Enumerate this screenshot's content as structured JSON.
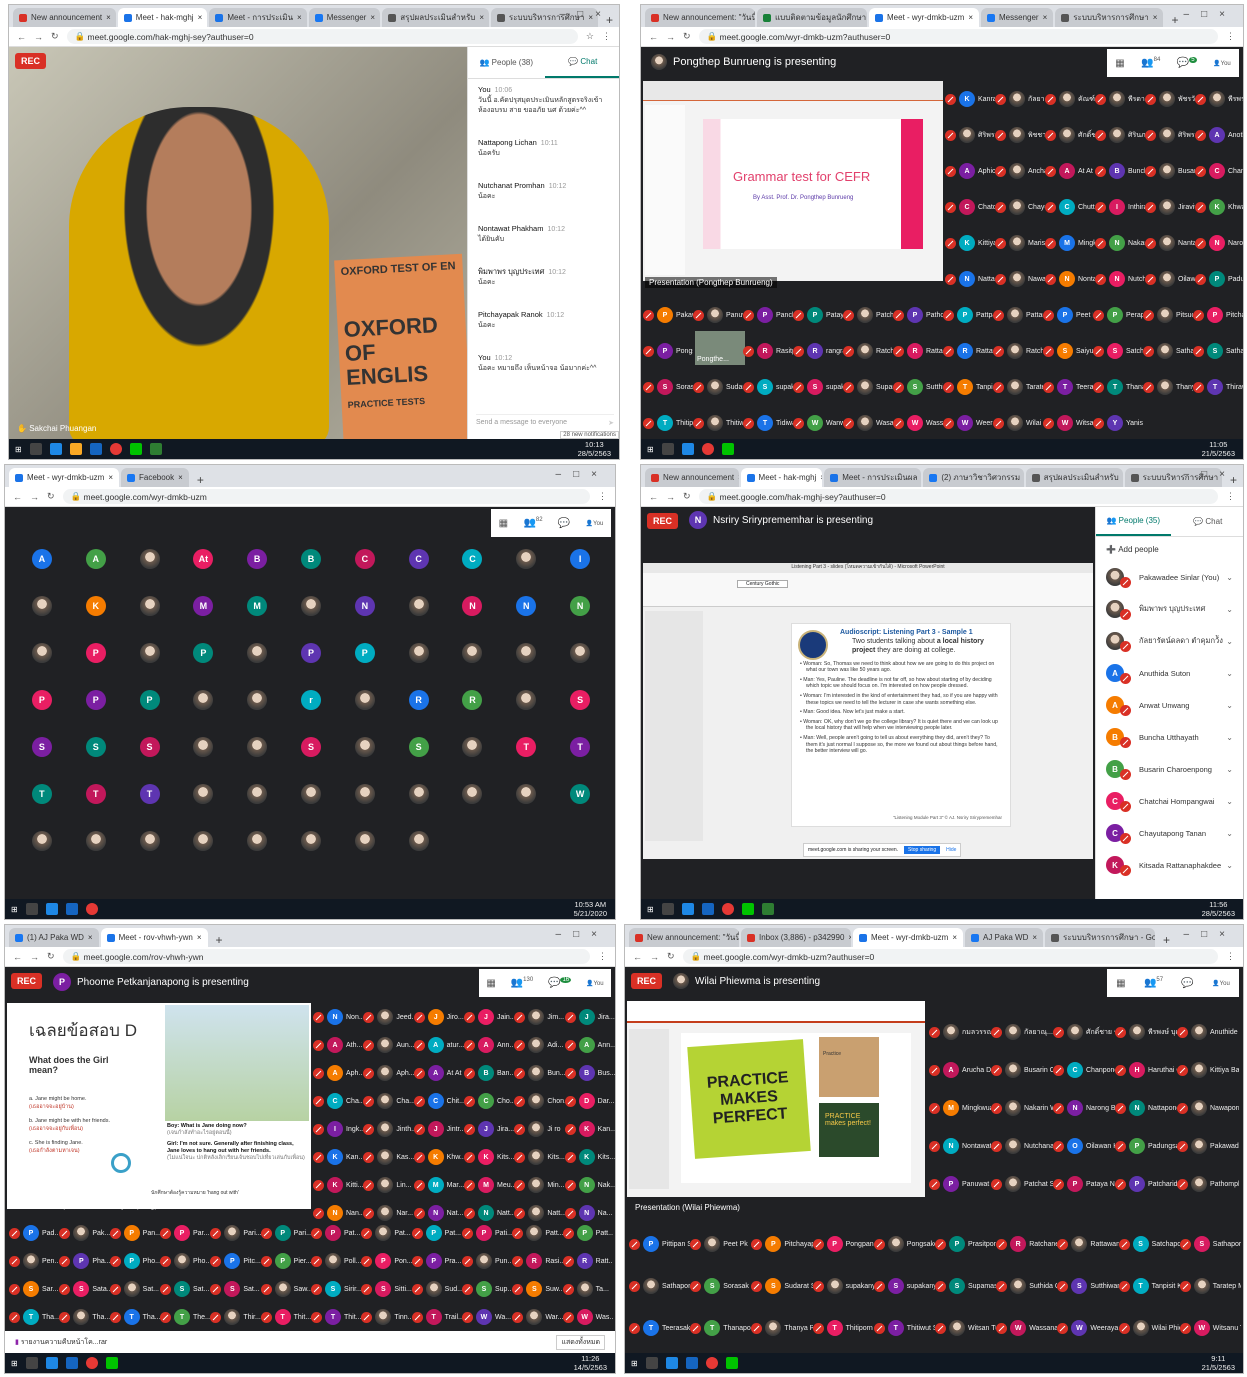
{
  "panel1": {
    "tabs": [
      {
        "label": "New announcement",
        "color": "#d93025"
      },
      {
        "label": "Meet - hak-mghj",
        "color": "#1a73e8",
        "active": true
      },
      {
        "label": "Meet - การประเมิน",
        "color": "#1a73e8"
      },
      {
        "label": "Messenger",
        "color": "#1877f2"
      },
      {
        "label": "สรุปผลประเมินสำหรับ",
        "color": "#555"
      },
      {
        "label": "ระบบบริหารการศึกษา",
        "color": "#555"
      }
    ],
    "url": "meet.google.com/hak-mghj-sey?authuser=0",
    "rec": "REC",
    "video_name": "Sakchai Phuangan",
    "book_text1": "OXFORD TEST OF EN",
    "book_text2": "OXFORD OF ENGLIS",
    "book_text3": "PRACTICE TESTS",
    "people_tab": "People (38)",
    "chat_tab": "Chat",
    "messages": [
      {
        "name": "You",
        "time": "10:06",
        "text": "วันนี้ อ.คัดปรุสมุดประเมินหลักสูตรจริงเข้าห้องอบรม สาย ขออภัย นศ ด้วยค่ะ^^"
      },
      {
        "name": "Nattapong Lichan",
        "time": "10:11",
        "text": "น้อครับ"
      },
      {
        "name": "Nutchanat Promhan",
        "time": "10:12",
        "text": "น้อคะ"
      },
      {
        "name": "Nontawat Phakham",
        "time": "10:12",
        "text": "ได้ยินคับ"
      },
      {
        "name": "พิมพาพร บุญประเทศ",
        "time": "10:12",
        "text": "น้อคะ"
      },
      {
        "name": "Pitchayapak Ranok",
        "time": "10:12",
        "text": "น้อคะ"
      },
      {
        "name": "You",
        "time": "10:12",
        "text": "น้อคะ หมายถึง เห็นหน้าจอ น้อมากค่ะ^^"
      }
    ],
    "send_placeholder": "Send a message to everyone",
    "new_notifications": "28 new notifications",
    "clock_time": "10:13",
    "clock_date": "28/5/2563"
  },
  "panel2": {
    "tabs": [
      {
        "label": "New announcement: \"วันนี้\"",
        "color": "#d93025"
      },
      {
        "label": "แบบติดตามข้อมูลนักศึกษา",
        "color": "#188038"
      },
      {
        "label": "Meet - wyr-dmkb-uzm",
        "color": "#1a73e8",
        "active": true
      },
      {
        "label": "Messenger",
        "color": "#1877f2"
      },
      {
        "label": "ระบบบริหารการศึกษา",
        "color": "#555"
      }
    ],
    "url": "meet.google.com/wyr-dmkb-uzm?authuser=0",
    "presenter": "Pongthep Bunrueng is presenting",
    "people_count": "84",
    "chat_count": "5",
    "you": "You",
    "slide_title": "Grammar test for CEFR",
    "slide_sub": "By Asst. Prof. Dr. Pongthep Bunrueng",
    "caption": "Presentation (Pongthep Bunrueng)",
    "presenter_tile": "Pongthe...",
    "rows": [
      [
        "Kanrat...",
        "กัลยาณุ...",
        "คัณฑ์กันต์...",
        "พีรดา บ...",
        "พัชรวัน...",
        "พีรพร ชั..."
      ],
      [
        "ศิริพร สี...",
        "พิชชาพร...",
        "ศักดิ์ชาย...",
        "ศิรินภา...",
        "ศิริพร...",
        "Anothid..."
      ],
      [
        "Aphichit...",
        "Ancha ...",
        "At At",
        "Buncha ...",
        "Busarin ...",
        "Chanipo..."
      ],
      [
        "Chatcha...",
        "Chayuta...",
        "Chutthai...",
        "Inthira S...",
        "Jiravit ...",
        "Khwanc..."
      ],
      [
        "Kittiya B...",
        "Marisa ...",
        "Mingkw...",
        "Nakarin ...",
        "Nantaw...",
        "Narong ..."
      ],
      [
        "Nattapo...",
        "Nawapo...",
        "Nontaw...",
        "Nutchan...",
        "Oilawan ...",
        "Padung..."
      ],
      [
        "Pakawa...",
        "Panuwa...",
        "Pancha...",
        "Pataya N...",
        "Patchari...",
        "Pathom...",
        "Pattpan ...",
        "Pattara...",
        "Peet Pk",
        "Perapas...",
        "Pitsuc...",
        "Pitchaya..."
      ],
      [
        "Pongsa...",
        "Pongthe...",
        "Rasitpo...",
        "rangrak...",
        "Ratchan...",
        "Rattakit ...",
        "Rattawa...",
        "Ratchrue...",
        "Saiyut ...",
        "Satchap...",
        "Sathapo...",
        "Sathapo..."
      ],
      [
        "Sorasak ...",
        "Sudarat ...",
        "supakan...",
        "supakan...",
        "Supama...",
        "Sutthiw...",
        "Tanpisit ...",
        "Taratep ...",
        "Teerasa...",
        "Thanap...",
        "Thanya ...",
        "Thirawa..."
      ],
      [
        "Thitipor...",
        "Thitiwut ...",
        "Tidiwat ...",
        "Wanwar...",
        "Wasan T...",
        "Wassan...",
        "Weeraya...",
        "Wilai Phi...",
        "Witsanu ...",
        "Yanisa P..."
      ]
    ],
    "clock_time": "11:05",
    "clock_date": "21/5/2563"
  },
  "panel3": {
    "tabs": [
      {
        "label": "Meet - wyr-dmkb-uzm",
        "color": "#1a73e8",
        "active": true
      },
      {
        "label": "Facebook",
        "color": "#1877f2"
      }
    ],
    "url": "meet.google.com/wyr-dmkb-uzm",
    "people_count": "82",
    "you": "You",
    "avatars": [
      "A",
      "A",
      "",
      "At",
      "B",
      "B",
      "C",
      "C",
      "C",
      "",
      "I",
      "",
      "K",
      "",
      "M",
      "M",
      "",
      "N",
      "",
      "N",
      "N",
      "N",
      "",
      "P",
      "",
      "P",
      "",
      "P",
      "P",
      "",
      "",
      "",
      "",
      "P",
      "P",
      "P",
      "",
      "",
      "r",
      "",
      "R",
      "R",
      "",
      "S",
      "S",
      "S",
      "S",
      "",
      "",
      "S",
      "",
      "S",
      "",
      "T",
      "T",
      "T",
      "T",
      "T",
      "",
      "",
      "",
      "",
      "",
      "",
      "",
      "W",
      "",
      "",
      "",
      "",
      "",
      "",
      "",
      ""
    ],
    "clock_time": "10:53 AM",
    "clock_date": "5/21/2020"
  },
  "panel4": {
    "tabs": [
      {
        "label": "New announcement",
        "color": "#d93025"
      },
      {
        "label": "Meet - hak-mghj",
        "color": "#1a73e8",
        "active": true
      },
      {
        "label": "Meet - การประเมินผล",
        "color": "#1a73e8"
      },
      {
        "label": "(2) ภาษาวิชาวิศวกรรม",
        "color": "#1877f2"
      },
      {
        "label": "สรุปผลประเมินสำหรับ",
        "color": "#555"
      },
      {
        "label": "ระบบบริหารการศึกษา",
        "color": "#555"
      }
    ],
    "url": "meet.google.com/hak-mghj-sey?authuser=0",
    "rec": "REC",
    "presenter": "Nsriry Sriryprememhar is presenting",
    "presenter_initial": "N",
    "ppt_title": "Listening Part 3 - slides (โหมดความเข้ากันได้) - Microsoft PowerPoint",
    "font_name": "Century Gothic",
    "script_title": "Audioscript: Listening Part 3 - Sample 1",
    "script_sub1": "Two students talking about",
    "script_sub_bold": "a local history",
    "script_sub2": "project",
    "script_sub3": "they are doing at college.",
    "lines": [
      "Woman: So, Thomas we need to think about how we are going to do this project on what our town was like 50 years ago.",
      "Man: Yes, Pauline. The deadline is not far off, so how about starting of by deciding which topic we should focus on. I'm interested on how people dressed.",
      "Woman: I'm interested in the kind of entertainment they had, so if you are happy with these topics we need to tell the lecturer in case she wants something else.",
      "Man: Good idea. Now let's just make a start.",
      "Woman: OK, why don't we go the college library? It is quiet there and we can look up the local history that will help when we interviewing people later.",
      "Man: Well, people aren't going to tell us about everything they did, aren't they? To them it's just normal I suppose so, the more we found out about things before hand, the better interview will go."
    ],
    "credit": "\"Listening Module Part 3\" © AJ. Nsriry Sriryprememhar",
    "share_notice": "meet.google.com is sharing your screen.",
    "stop_sharing": "Stop sharing",
    "hide": "Hide",
    "people_tab": "People (35)",
    "chat_tab": "Chat",
    "add_people": "Add people",
    "people": [
      {
        "name": "Pakawadee Sinlar (You)",
        "initial": "",
        "color": ""
      },
      {
        "name": "พิมพาพร บุญประเทศ",
        "initial": "",
        "color": ""
      },
      {
        "name": "กัลยารัตน์ดลดา ตำคุมกว้ัง",
        "initial": "",
        "color": ""
      },
      {
        "name": "Anuthida Suton",
        "initial": "A",
        "color": "#1a73e8"
      },
      {
        "name": "Anwat Unwang",
        "initial": "A",
        "color": "#f57c00"
      },
      {
        "name": "Buncha Utthayath",
        "initial": "B",
        "color": "#f57c00"
      },
      {
        "name": "Busarin Charoenpong",
        "initial": "B",
        "color": "#43a047"
      },
      {
        "name": "Chatchai Hompangwai",
        "initial": "C",
        "color": "#e91e63"
      },
      {
        "name": "Chayutapong Tanan",
        "initial": "C",
        "color": "#7b1fa2"
      },
      {
        "name": "Kitsada Rattanaphakdee",
        "initial": "K",
        "color": "#c2185b"
      }
    ],
    "clock_time": "11:56",
    "clock_date": "28/5/2563"
  },
  "panel5": {
    "tabs": [
      {
        "label": "(1) AJ Paka WD",
        "color": "#1877f2"
      },
      {
        "label": "Meet - rov-vhwh-ywn",
        "color": "#1a73e8",
        "active": true
      }
    ],
    "url": "meet.google.com/rov-vhwh-ywn",
    "rec": "REC",
    "presenter": "Phoome Petkanjanapong is presenting",
    "presenter_initial": "P",
    "people_count": "130",
    "chat_count": "16",
    "you": "You",
    "slide_heading": "เฉลยข้อสอบ D",
    "question": "What does the Girl mean?",
    "options": [
      {
        "en": "a.  Jane might be home.",
        "th": "(เธออาจจะอยู่บ้าน)"
      },
      {
        "en": "b.  Jane might be with her friends.",
        "th": "(เธออาจจะอยู่กับเพื่อน)"
      },
      {
        "en": "c.  She is finding Jane.",
        "th": "(เธอกำลังตามหาเจน)"
      }
    ],
    "boy_line": "Boy: What is Jane doing now?",
    "boy_th": "(เจนกำลังทำอะไรอยู่ตอนนี้)",
    "girl_line": "Girl: I'm not sure. Generally after finishing class, Jane loves to hang out with her friends.",
    "girl_th": "(ไม่แน่ใจนะ ปกติหลังเลิกเรียนเจ้นชอบไปเที่ยวเล่นกับเพื่อน)",
    "note": "นักศึกษาต้องรู้ความหมาย 'hang out with'",
    "caption": "Presentation (Phoome Petkanjanapong)",
    "side_names": [
      "Non...",
      "Jeed...",
      "Jiro...",
      "Jain...",
      "Jim...",
      "Jira...",
      "Ath...",
      "Aun...",
      "atur...",
      "Ann...",
      "Adi...",
      "Ann...",
      "Aph...",
      "Aph...",
      "At At",
      "Ban...",
      "Bun...",
      "Bus...",
      "Cha...",
      "Cha...",
      "Chit...",
      "Cho...",
      "Chon...",
      "Dar...",
      "Ingk...",
      "Jinth...",
      "Jintr...",
      "Jira...",
      "Ji ro",
      "Kan...",
      "Kan...",
      "Kas...",
      "Khw...",
      "Kits...",
      "Kits...",
      "Kits...",
      "Kitti...",
      "Lin...",
      "Mar...",
      "Meu...",
      "Min...",
      "Nak...",
      "Nan...",
      "Nar...",
      "Nat...",
      "Natt...",
      "Natt...",
      "Na...",
      "Net...",
      "Non...",
      "Nut...",
      "Pac..."
    ],
    "bottom_rows": [
      [
        "Pad...",
        "Pak...",
        "Pan...",
        "Par...",
        "Pari...",
        "Pari...",
        "Pat...",
        "Pat...",
        "Pat...",
        "Pati...",
        "Patt...",
        "Patt..."
      ],
      [
        "Pen...",
        "Pha...",
        "Pho...",
        "Pho...",
        "Pitc...",
        "Pier...",
        "Poll...",
        "Pon...",
        "Pra...",
        "Pun...",
        "Rasi...",
        "Ratt...",
        "Ritti...",
        "Rue..."
      ],
      [
        "Sar...",
        "Sata...",
        "Sat...",
        "Sat...",
        "Sat...",
        "Saw...",
        "Sirir...",
        "Sitti...",
        "Sud...",
        "Sup...",
        "Suw...",
        "Ta...",
        "Tan...",
        "Tara...",
        "Teer...",
        "Teer..."
      ],
      [
        "Tha...",
        "Tha...",
        "Tha...",
        "The...",
        "Thir...",
        "Thit...",
        "Thit...",
        "Tinn...",
        "Trail...",
        "Wa...",
        "War...",
        "Was...",
        "Wee...",
        "Wila...",
        "Wit..."
      ]
    ],
    "download": "รายงานความคืบหน้าโค...rar",
    "show_all": "แสดงทั้งหมด",
    "clock_time": "11:26",
    "clock_date": "14/5/2563"
  },
  "panel6": {
    "tabs": [
      {
        "label": "New announcement: \"วันนี้\"",
        "color": "#d93025"
      },
      {
        "label": "Inbox (3,886) - p342990",
        "color": "#d93025"
      },
      {
        "label": "Meet - wyr-dmkb-uzm",
        "color": "#1a73e8",
        "active": true
      },
      {
        "label": "AJ Paka WD",
        "color": "#1877f2"
      },
      {
        "label": "ระบบบริหารการศึกษา - Goo",
        "color": "#555"
      }
    ],
    "url": "meet.google.com/wyr-dmkb-uzm?authuser=0",
    "rec": "REC",
    "presenter": "Wilai Phiewma is presenting",
    "people_count": "57",
    "you": "You",
    "note_text": "PRACTICE MAKES PERFECT",
    "sticky1": "Practice",
    "sticky2": "PRACTICE makes perfect!",
    "caption": "Presentation (Wilai Phiewma)",
    "right_rows": [
      [
        "กมลวรรณ น...",
        "กัลยาณุ...",
        "ศักดิ์ชาย ชูใจ",
        "พีรพงษ์ บุญ...",
        "Anuthide S...",
        "Aphichit Sa..."
      ],
      [
        "Arucha Don...",
        "Busarin Cha...",
        "Chanpond ...",
        "Haruthai On...",
        "Kittiya Bapp..."
      ],
      [
        "Mingkwuan...",
        "Nakarin Wa...",
        "Narong Boo...",
        "Nattapong ...",
        "Nawaporn ..."
      ],
      [
        "Nontawat P...",
        "Nutchanat ...",
        "Oilawan Kro...",
        "Padungsak ...",
        "Pakawadee..."
      ],
      [
        "Panuwat Ch...",
        "Patchat Sri...",
        "Pataya Nara...",
        "Patcharida ...",
        "Pathompho..."
      ]
    ],
    "bottom_rows": [
      [
        "Pittipan So...",
        "Peet Pk",
        "Pitchayapa...",
        "Pongpan P...",
        "Pongsakorn...",
        "Prasitpon N...",
        "Ratchaneep...",
        "Rattawan B...",
        "Satchapon ...",
        "Sathaporn ..."
      ],
      [
        "Sathaporn ...",
        "Sorasak Se...",
        "Sudarat Sa...",
        "supakanya ...",
        "supakanya ...",
        "Supamas N...",
        "Suthida Cha...",
        "Sutthiwan...",
        "Tanpisit Ko...",
        "Taratep Mai..."
      ],
      [
        "Teerasak K...",
        "Thanapon S...",
        "Thanya Pho...",
        "Thitiporn R...",
        "Thitiwut Sri...",
        "Witsan Tura...",
        "Wassana P...",
        "Weeraya Ph...",
        "Wilai Phiew...",
        "Witsanu Th..."
      ]
    ],
    "clock_time": "9:11",
    "clock_date": "21/5/2563"
  }
}
